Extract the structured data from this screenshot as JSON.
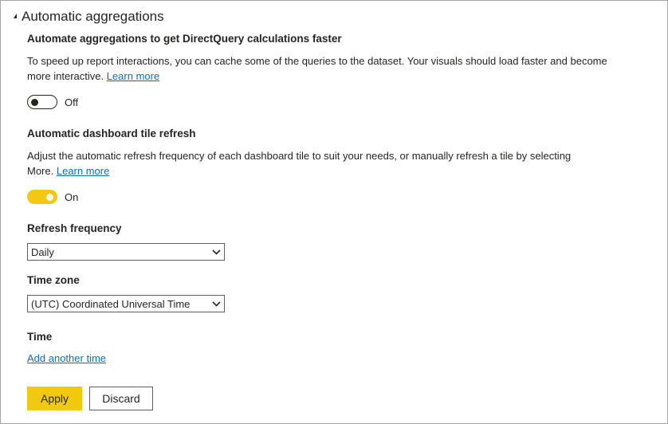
{
  "section": {
    "title": "Automatic aggregations"
  },
  "aggregations": {
    "heading": "Automate aggregations to get DirectQuery calculations faster",
    "description_line1": "To speed up report interactions, you can cache some of the queries to the dataset. Your visuals should load faster and become",
    "description_line2": "more interactive.",
    "learn_more": "Learn more",
    "toggle_state": "Off"
  },
  "tile_refresh": {
    "heading": "Automatic dashboard tile refresh",
    "description_line1": "Adjust the automatic refresh frequency of each dashboard tile to suit your needs, or manually refresh a tile by selecting",
    "description_line2": "More.",
    "learn_more": "Learn more",
    "toggle_state": "On"
  },
  "refresh_frequency": {
    "label": "Refresh frequency",
    "selected": "Daily"
  },
  "time_zone": {
    "label": "Time zone",
    "selected": "(UTC) Coordinated Universal Time"
  },
  "time": {
    "label": "Time",
    "add_link": "Add another time"
  },
  "actions": {
    "apply": "Apply",
    "discard": "Discard"
  },
  "colors": {
    "accent": "#f2c811",
    "link": "#0f6cbd",
    "text": "#252423"
  },
  "icons": {
    "section_caret": "caret-collapse-icon",
    "dropdown": "chevron-down-icon"
  }
}
